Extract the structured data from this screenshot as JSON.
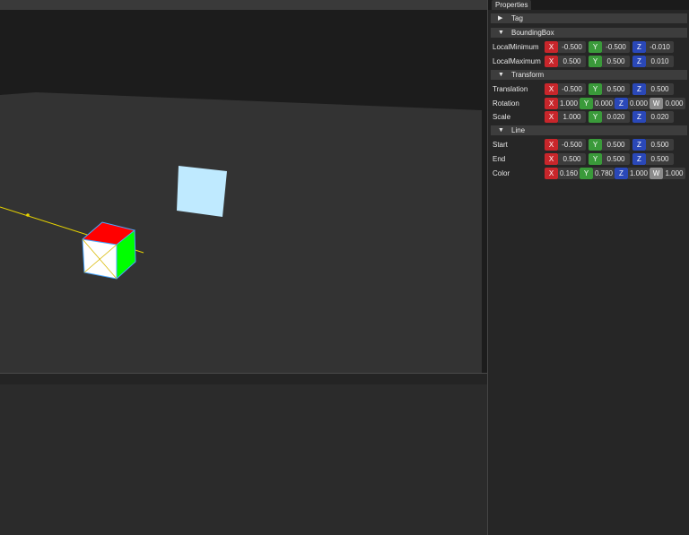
{
  "properties_tab": {
    "label": "Properties"
  },
  "sections": {
    "tag": {
      "title": "Tag",
      "expanded": false,
      "arrow": "▶"
    },
    "bounding_box": {
      "title": "BoundingBox",
      "expanded": true,
      "arrow": "▼"
    },
    "transform": {
      "title": "Transform",
      "expanded": true,
      "arrow": "▼"
    },
    "line": {
      "title": "Line",
      "expanded": true,
      "arrow": "▼"
    }
  },
  "rows": {
    "local_minimum": {
      "label": "LocalMinimum",
      "x": "-0.500",
      "y": "-0.500",
      "z": "-0.010"
    },
    "local_maximum": {
      "label": "LocalMaximum",
      "x": "0.500",
      "y": "0.500",
      "z": "0.010"
    },
    "translation": {
      "label": "Translation",
      "x": "-0.500",
      "y": "0.500",
      "z": "0.500"
    },
    "rotation": {
      "label": "Rotation",
      "x": "1.000",
      "y": "0.000",
      "z": "0.000",
      "w": "0.000"
    },
    "scale": {
      "label": "Scale",
      "x": "1.000",
      "y": "0.020",
      "z": "0.020"
    },
    "start": {
      "label": "Start",
      "x": "-0.500",
      "y": "0.500",
      "z": "0.500"
    },
    "end": {
      "label": "End",
      "x": "0.500",
      "y": "0.500",
      "z": "0.500"
    },
    "color": {
      "label": "Color",
      "x": "0.160",
      "y": "0.780",
      "z": "1.000",
      "w": "1.000"
    }
  },
  "axis_letters": {
    "x": "X",
    "y": "Y",
    "z": "Z",
    "w": "W"
  },
  "colors": {
    "axis_x": "#c8262b",
    "axis_y": "#3a9a3a",
    "axis_z": "#2a48b8",
    "axis_w": "#8a8a8a",
    "line": "#e8d400",
    "quad": "#bfeaff",
    "cube_top": "#ff0000",
    "cube_side": "#00ff00",
    "cube_front": "#ffffff"
  }
}
